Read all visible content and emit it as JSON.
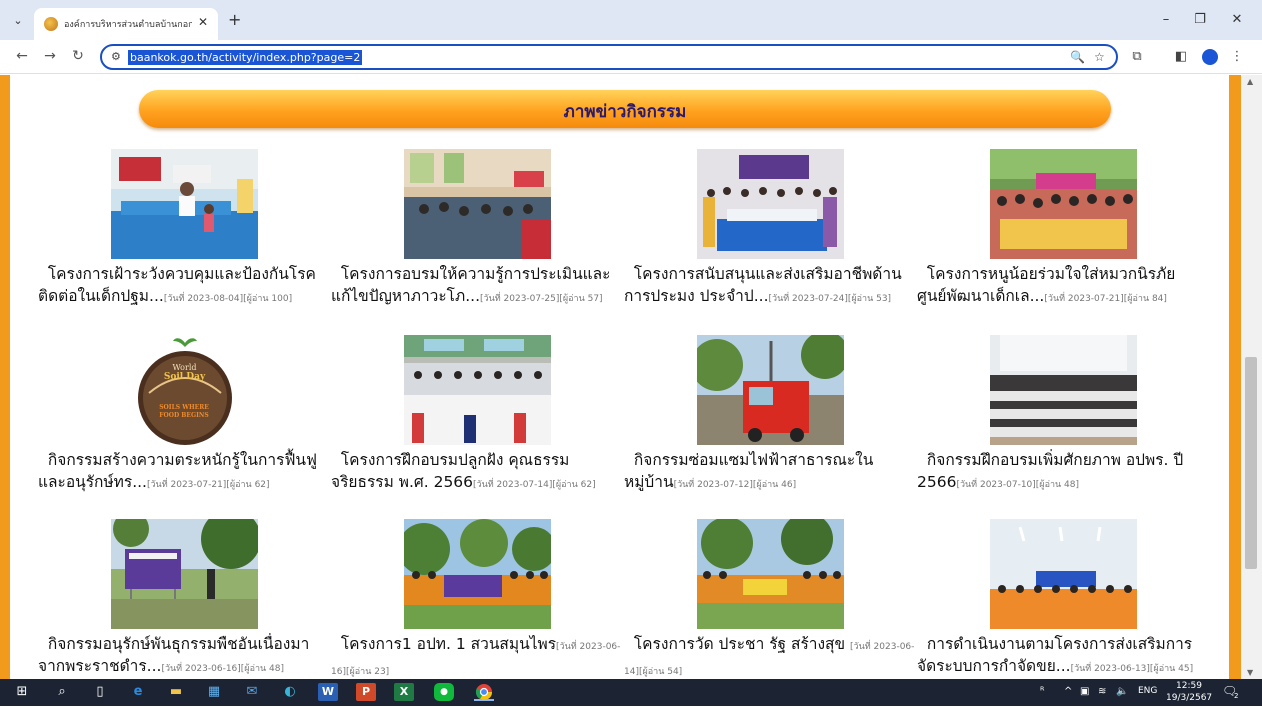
{
  "browser": {
    "tab_title": "องค์การบริหารส่วนตำบลบ้านกอก อำเ",
    "url": "baankok.go.th/activity/index.php?page=2"
  },
  "page": {
    "banner_title": "ภาพข่าวกิจกรรม",
    "cards": [
      {
        "title": "โครงการเฝ้าระวังควบคุมและป้องกันโรคติดต่อในเด็กปฐม...",
        "meta": "[วันที่ 2023-08-04][ผู้อ่าน 100]"
      },
      {
        "title": "โครงการอบรมให้ความรู้การประเมินและแก้ไขปัญหาภาวะโภ...",
        "meta": "[วันที่ 2023-07-25][ผู้อ่าน 57]"
      },
      {
        "title": "โครงการสนับสนุนและส่งเสริมอาชีพด้านการประมง ประจำป...",
        "meta": "[วันที่ 2023-07-24][ผู้อ่าน 53]"
      },
      {
        "title": "โครงการหนูน้อยร่วมใจใส่หมวกนิรภัย ศูนย์พัฒนาเด็กเล...",
        "meta": "[วันที่ 2023-07-21][ผู้อ่าน 84]"
      },
      {
        "title": "กิจกรรมสร้างความตระหนักรู้ในการฟื้นฟูและอนุรักษ์ทร...",
        "meta": "[วันที่ 2023-07-21][ผู้อ่าน 62]"
      },
      {
        "title": "โครงการฝึกอบรมปลูกฝัง คุณธรรม จริยธรรม พ.ศ. 2566",
        "meta": "[วันที่ 2023-07-14][ผู้อ่าน 62]"
      },
      {
        "title": "กิจกรรมซ่อมแซมไฟฟ้าสาธารณะในหมู่บ้าน",
        "meta": "[วันที่ 2023-07-12][ผู้อ่าน 46]"
      },
      {
        "title": "กิจกรรมฝึกอบรมเพิ่มศักยภาพ อปพร. ปี 2566",
        "meta": "[วันที่ 2023-07-10][ผู้อ่าน 48]"
      },
      {
        "title": "กิจกรรมอนุรักษ์พันธุกรรมพืชอันเนื่องมาจากพระราชดำร...",
        "meta": "[วันที่ 2023-06-16][ผู้อ่าน 48]"
      },
      {
        "title": "โครงการ1 อปท. 1 สวนสมุนไพร",
        "meta": "[วันที่ 2023-06-16][ผู้อ่าน 23]"
      },
      {
        "title": "โครงการวัด ประชา รัฐ สร้างสุข ",
        "meta": "[วันที่ 2023-06-14][ผู้อ่าน 54]"
      },
      {
        "title": "การดำเนินงานตามโครงการส่งเสริมการจัดระบบการกำจัดขย...",
        "meta": "[วันที่ 2023-06-13][ผู้อ่าน 45]"
      }
    ],
    "soil_logo": {
      "top": "World",
      "mid": "Soil Day",
      "bottom": "SOILS WHERE FOOD BEGINS"
    }
  },
  "taskbar": {
    "language": "ENG",
    "time": "12:59",
    "date": "19/3/2567",
    "notification_count": "2"
  }
}
